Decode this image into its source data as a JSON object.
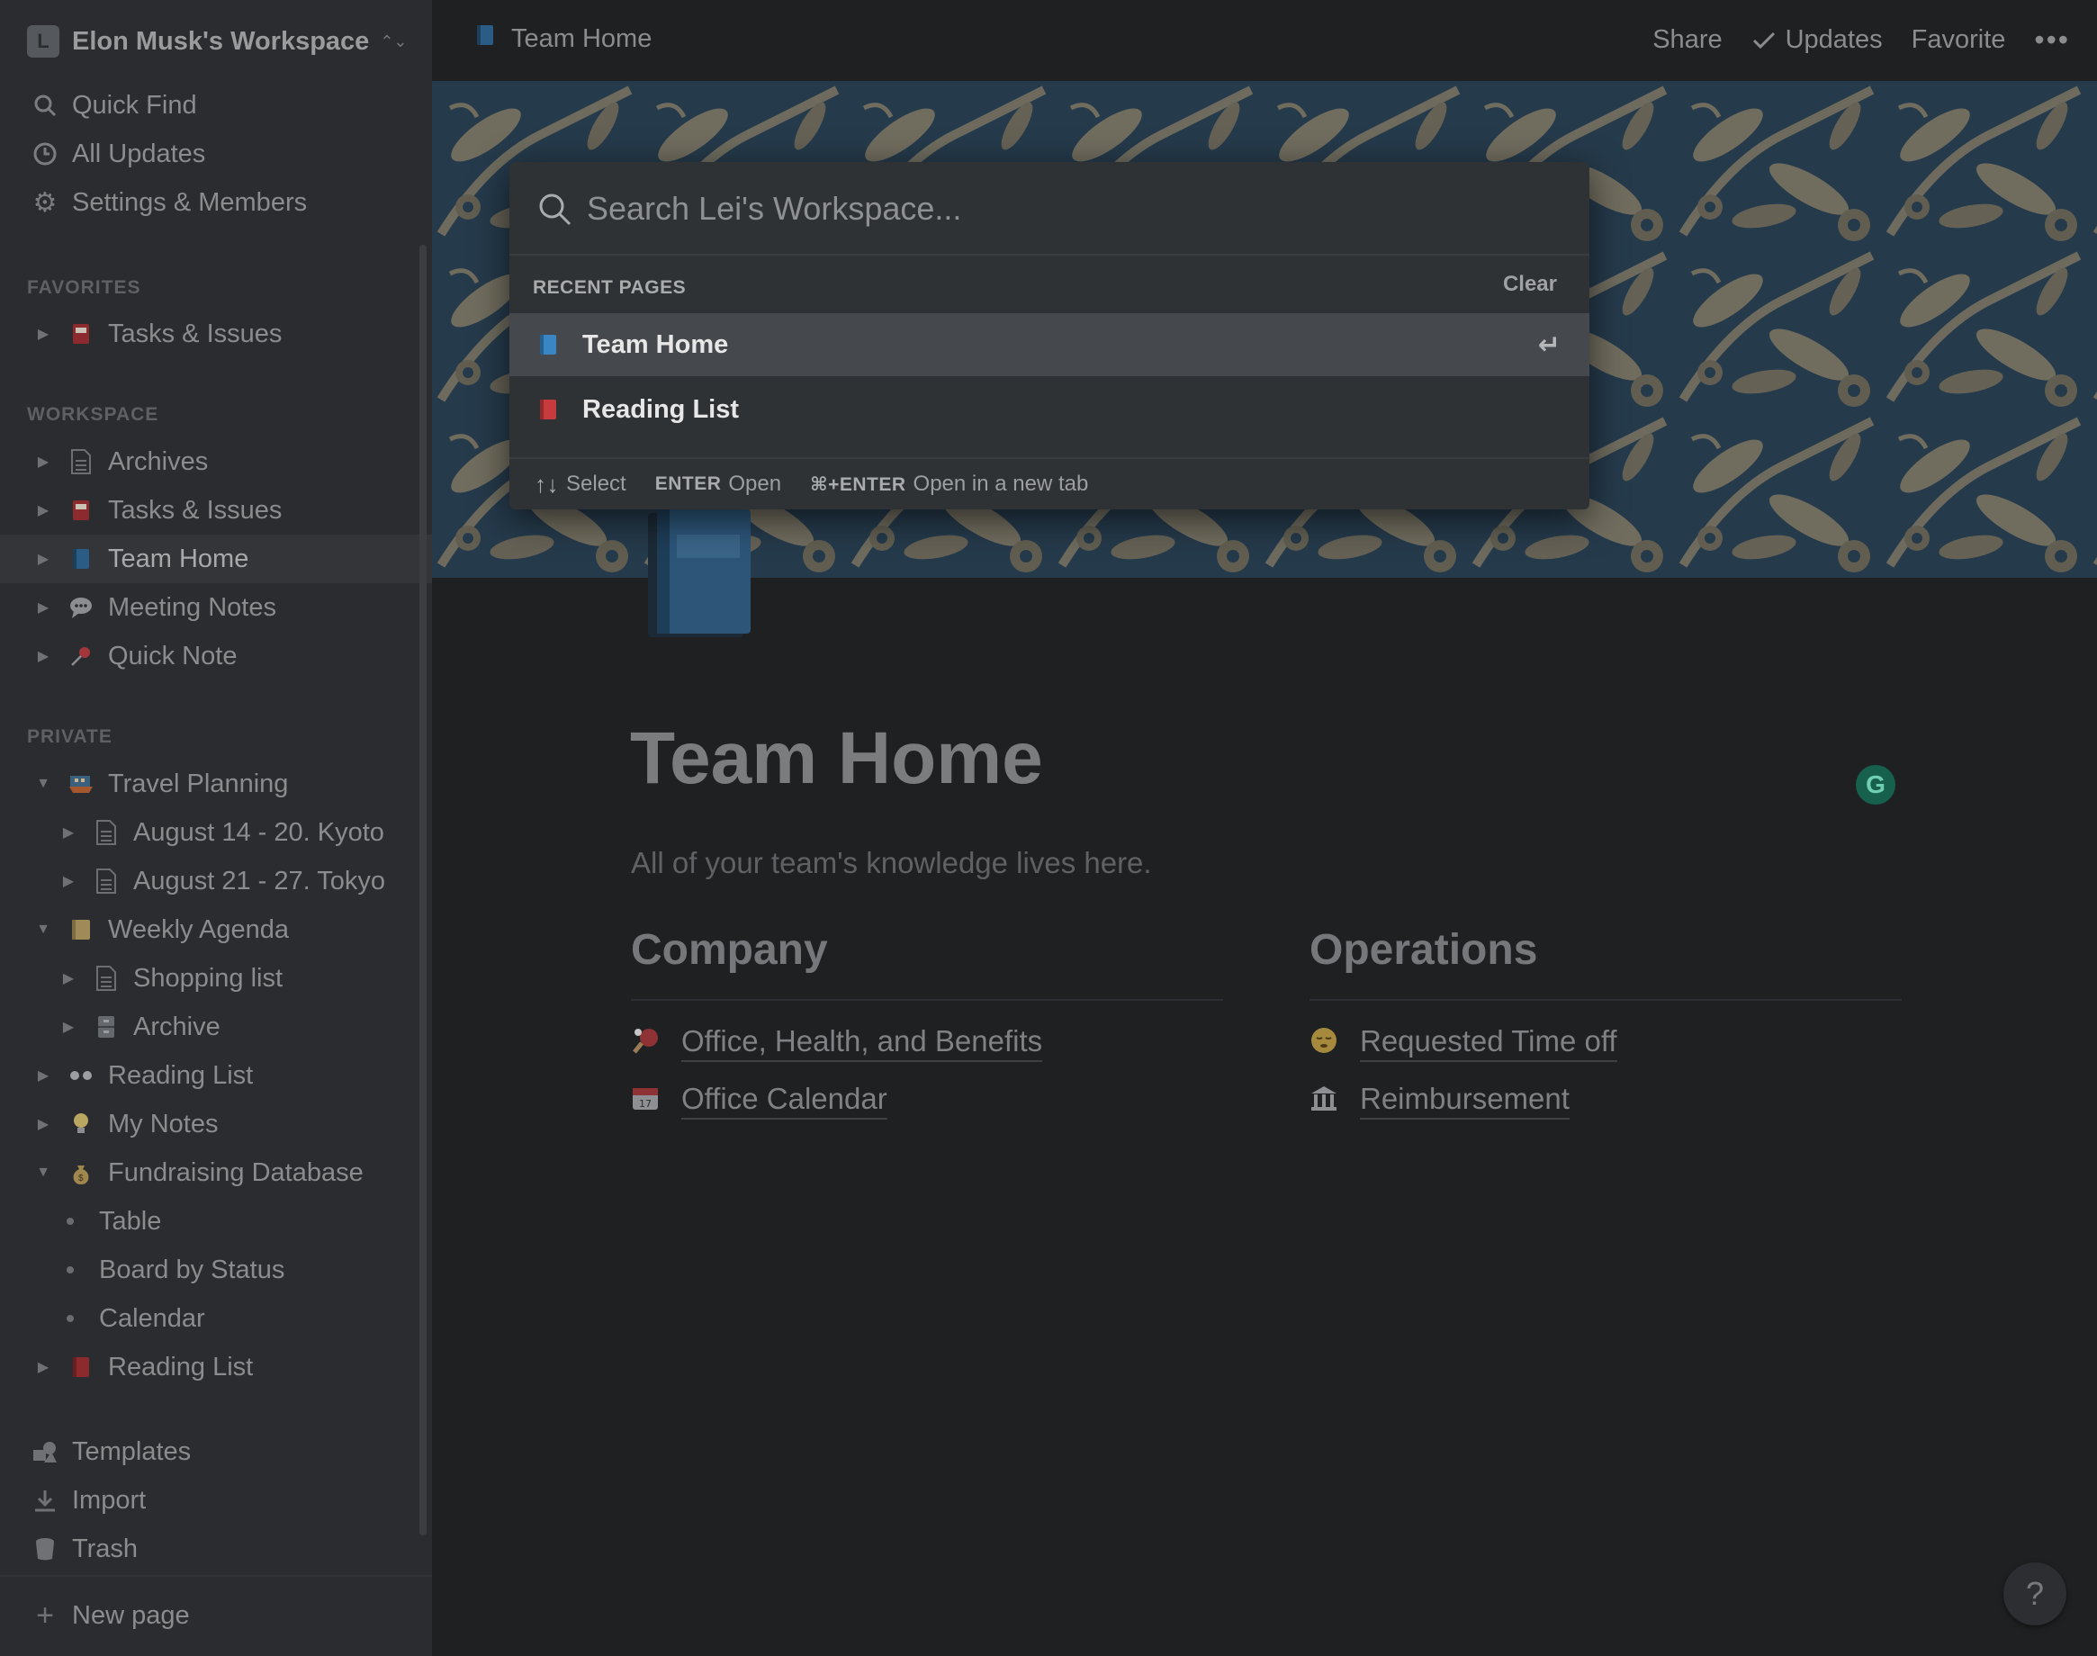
{
  "sidebar": {
    "workspace": {
      "badge": "L",
      "name": "Elon Musk's Workspace",
      "chevron": "⌃"
    },
    "top_items": [
      {
        "label": "Quick Find",
        "icon": "search-icon"
      },
      {
        "label": "All Updates",
        "icon": "clock-icon"
      },
      {
        "label": "Settings & Members",
        "icon": "gear-icon"
      }
    ],
    "favorites_title": "FAVORITES",
    "favorites": [
      {
        "label": "Tasks & Issues",
        "icon": "red-book-icon"
      }
    ],
    "workspace_title": "WORKSPACE",
    "workspace_items": [
      {
        "label": "Archives",
        "icon": "document-icon"
      },
      {
        "label": "Tasks & Issues",
        "icon": "red-book-icon"
      },
      {
        "label": "Team Home",
        "icon": "blue-book-icon"
      },
      {
        "label": "Meeting Notes",
        "icon": "speech-bubble-icon"
      },
      {
        "label": "Quick Note",
        "icon": "pushpin-icon"
      }
    ],
    "private_title": "PRIVATE",
    "private_items": [
      {
        "label": "Travel Planning",
        "icon": "ship-icon"
      },
      {
        "label": "August 14 - 20. Kyoto",
        "icon": "document-icon"
      },
      {
        "label": "August 21 - 27. Tokyo",
        "icon": "document-icon"
      },
      {
        "label": "Weekly Agenda",
        "icon": "notebook-icon"
      },
      {
        "label": "Shopping list",
        "icon": "document-icon"
      },
      {
        "label": "Archive",
        "icon": "file-cabinet-icon"
      },
      {
        "label": "Reading List",
        "icon": "eyes-icon"
      },
      {
        "label": "My Notes",
        "icon": "lightbulb-icon"
      },
      {
        "label": "Fundraising Database",
        "icon": "money-bag-icon"
      },
      {
        "label": "Table"
      },
      {
        "label": "Board by Status"
      },
      {
        "label": "Calendar"
      },
      {
        "label": "Reading List",
        "icon": "red-book-icon"
      }
    ],
    "bottom_items": [
      {
        "label": "Templates",
        "icon": "templates-icon"
      },
      {
        "label": "Import",
        "icon": "import-icon"
      },
      {
        "label": "Trash",
        "icon": "trash-icon"
      }
    ],
    "new_page": "New page"
  },
  "topbar": {
    "breadcrumb": "Team Home",
    "share": "Share",
    "updates": "Updates",
    "favorite": "Favorite",
    "more": "•••"
  },
  "page": {
    "title": "Team Home",
    "description": "All of your team's knowledge lives here.",
    "columns": [
      {
        "heading": "Company",
        "links": [
          {
            "label": "Office, Health, and Benefits",
            "icon": "ping-pong-icon"
          },
          {
            "label": "Office Calendar",
            "icon": "calendar-icon"
          }
        ]
      },
      {
        "heading": "Operations",
        "links": [
          {
            "label": "Requested Time off",
            "icon": "sleepy-face-icon"
          },
          {
            "label": "Reimbursement",
            "icon": "bank-icon"
          }
        ]
      }
    ],
    "grammarly": "G",
    "help": "?"
  },
  "quick_find": {
    "placeholder": "Search Lei's Workspace...",
    "section_label": "RECENT PAGES",
    "clear": "Clear",
    "results": [
      {
        "label": "Team Home",
        "icon": "blue-book-icon",
        "selected": true
      },
      {
        "label": "Reading List",
        "icon": "red-book-icon",
        "selected": false
      }
    ],
    "enter_glyph": "↵",
    "footer": {
      "nav_keys": "↑↓",
      "nav_label": "Select",
      "open_key": "ENTER",
      "open_label": "Open",
      "newtab_key": "⌘+ENTER",
      "newtab_label": "Open in a new tab"
    }
  },
  "colors": {
    "background": "#1e2022",
    "sidebar": "#2a2c2f",
    "modal": "#2f3235",
    "selected_row": "#45484c",
    "grammarly": "#17604d"
  }
}
